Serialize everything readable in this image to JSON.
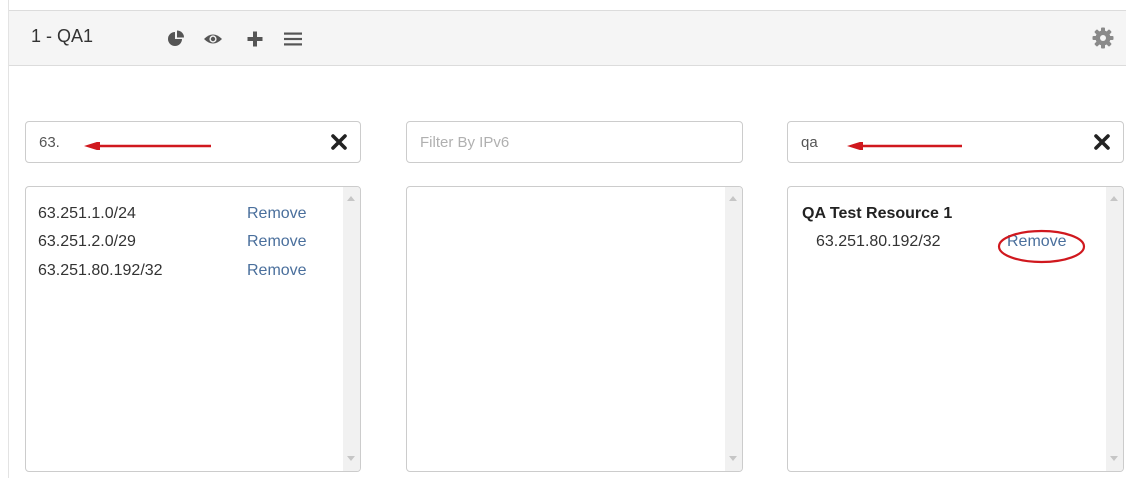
{
  "header": {
    "title": "1 - QA1"
  },
  "filters": {
    "ipv4": {
      "value": "63.",
      "placeholder": ""
    },
    "ipv6": {
      "value": "",
      "placeholder": "Filter By IPv6"
    },
    "resource": {
      "value": "qa",
      "placeholder": ""
    }
  },
  "ipv4_list": [
    {
      "cidr": "63.251.1.0/24",
      "action": "Remove"
    },
    {
      "cidr": "63.251.2.0/29",
      "action": "Remove"
    },
    {
      "cidr": "63.251.80.192/32",
      "action": "Remove"
    }
  ],
  "resources": [
    {
      "name": "QA Test Resource 1",
      "items": [
        {
          "cidr": "63.251.80.192/32",
          "action": "Remove"
        }
      ]
    }
  ],
  "colors": {
    "annotation": "#d0181e",
    "link": "#4a6f9c"
  },
  "icons": [
    "pie-chart-icon",
    "eye-icon",
    "plus-icon",
    "menu-icon",
    "gear-icon",
    "clear-icon"
  ]
}
